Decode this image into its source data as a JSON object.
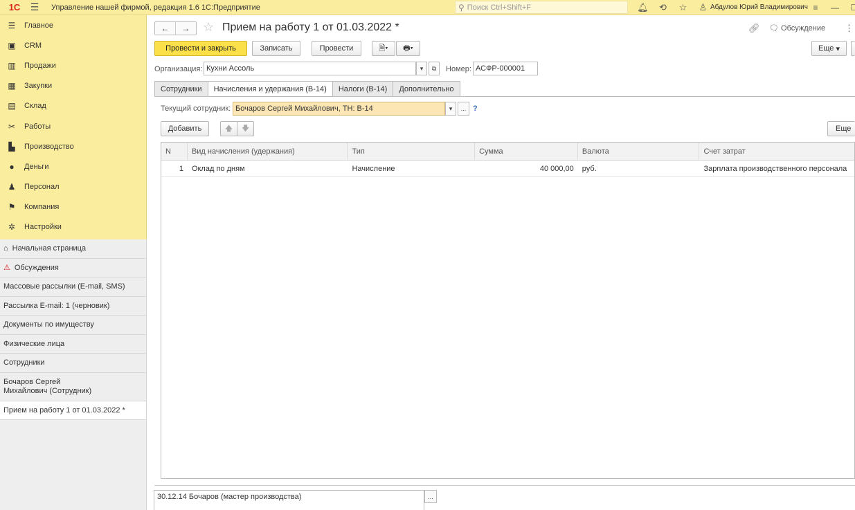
{
  "topbar": {
    "logo": "1С",
    "app_title": "Управление нашей фирмой, редакция 1.6 1С:Предприятие",
    "search_placeholder": "Поиск Ctrl+Shift+F",
    "user_name": "Абдулов Юрий Владимирович"
  },
  "sidebar": {
    "sections": [
      {
        "label": "Главное",
        "icon": "menu-icon"
      },
      {
        "label": "CRM",
        "icon": "crm-icon"
      },
      {
        "label": "Продажи",
        "icon": "basket-icon"
      },
      {
        "label": "Закупки",
        "icon": "purchase-icon"
      },
      {
        "label": "Склад",
        "icon": "warehouse-icon"
      },
      {
        "label": "Работы",
        "icon": "tools-icon"
      },
      {
        "label": "Производство",
        "icon": "factory-icon"
      },
      {
        "label": "Деньги",
        "icon": "money-icon"
      },
      {
        "label": "Персонал",
        "icon": "people-icon"
      },
      {
        "label": "Компания",
        "icon": "flag-icon"
      },
      {
        "label": "Настройки",
        "icon": "gear-icon"
      }
    ],
    "open_windows": [
      {
        "label": "Начальная страница",
        "icon": "home-icon"
      },
      {
        "label": "Обсуждения",
        "icon": "warning-icon"
      },
      {
        "label": "Массовые рассылки (E-mail, SMS)"
      },
      {
        "label": "Рассылка E-mail: 1  (черновик)"
      },
      {
        "label": "Документы по имуществу"
      },
      {
        "label": "Физические лица"
      },
      {
        "label": "Сотрудники"
      },
      {
        "label": "Бочаров Сергей Михайлович (Сотрудник)"
      },
      {
        "label": "Прием на работу 1 от 01.03.2022 *"
      }
    ]
  },
  "document": {
    "title": "Прием на работу 1 от 01.03.2022 *",
    "discussion_label": "Обсуждение",
    "toolbar": {
      "post_close": "Провести и закрыть",
      "save": "Записать",
      "post": "Провести",
      "more": "Еще"
    },
    "organization_label": "Организация:",
    "organization_value": "Кухни Ассоль",
    "number_label": "Номер:",
    "number_value": "АСФР-000001",
    "tabs": [
      "Сотрудники",
      "Начисления и удержания (В-14)",
      "Налоги (В-14)",
      "Дополнительно"
    ],
    "active_tab": 1,
    "current_employee_label": "Текущий сотрудник:",
    "current_employee_value": "Бочаров Сергей Михайлович, ТН: В-14",
    "help": "?",
    "add_button": "Добавить",
    "table_more": "Еще",
    "table": {
      "columns": [
        "N",
        "Вид начисления (удержания)",
        "Тип",
        "Сумма",
        "Валюта",
        "Счет затрат"
      ],
      "rows": [
        {
          "n": "1",
          "kind": "Оклад по дням",
          "type": "Начисление",
          "sum": "40 000,00",
          "currency": "руб.",
          "account": "Зарплата производственного персонала"
        }
      ]
    },
    "comment": "30.12.14 Бочаров (мастер производства)"
  }
}
